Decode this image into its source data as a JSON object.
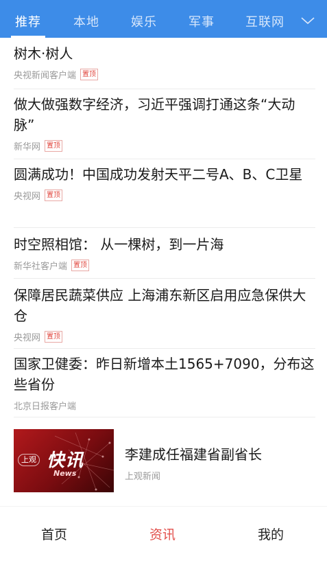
{
  "tabs": [
    {
      "label": "推荐"
    },
    {
      "label": "本地"
    },
    {
      "label": "娱乐"
    },
    {
      "label": "军事"
    },
    {
      "label": "互联网"
    }
  ],
  "active_tab_index": 0,
  "feed": [
    {
      "title": "树木·树人",
      "source": "央视新闻客户端",
      "badge": "置顶"
    },
    {
      "title": "做大做强数字经济，习近平强调打通这条“大动脉”",
      "source": "新华网",
      "badge": "置顶"
    },
    {
      "title": "圆满成功！中国成功发射天平二号A、B、C卫星",
      "source": "央视网",
      "badge": "置顶"
    },
    {
      "title": "时空照相馆： 从一棵树，到一片海",
      "source": "新华社客户端",
      "badge": "置顶"
    },
    {
      "title": "保障居民蔬菜供应 上海浦东新区启用应急保供大仓",
      "source": "央视网",
      "badge": "置顶"
    },
    {
      "title": "国家卫健委：昨日新增本土1565+7090，分布这些省份",
      "source": "北京日报客户端",
      "badge": ""
    }
  ],
  "image_item": {
    "title": "李建成任福建省副省长",
    "source": "上观新闻",
    "thumb_logo": "上观",
    "thumb_text": "快讯",
    "thumb_subtext": "News"
  },
  "bottom_nav": [
    {
      "label": "首页"
    },
    {
      "label": "资讯"
    },
    {
      "label": "我的"
    }
  ],
  "active_bottom_index": 1,
  "colors": {
    "accent": "#3d8ce8",
    "badge_red": "#e0463d",
    "active_nav": "#e2504c"
  }
}
